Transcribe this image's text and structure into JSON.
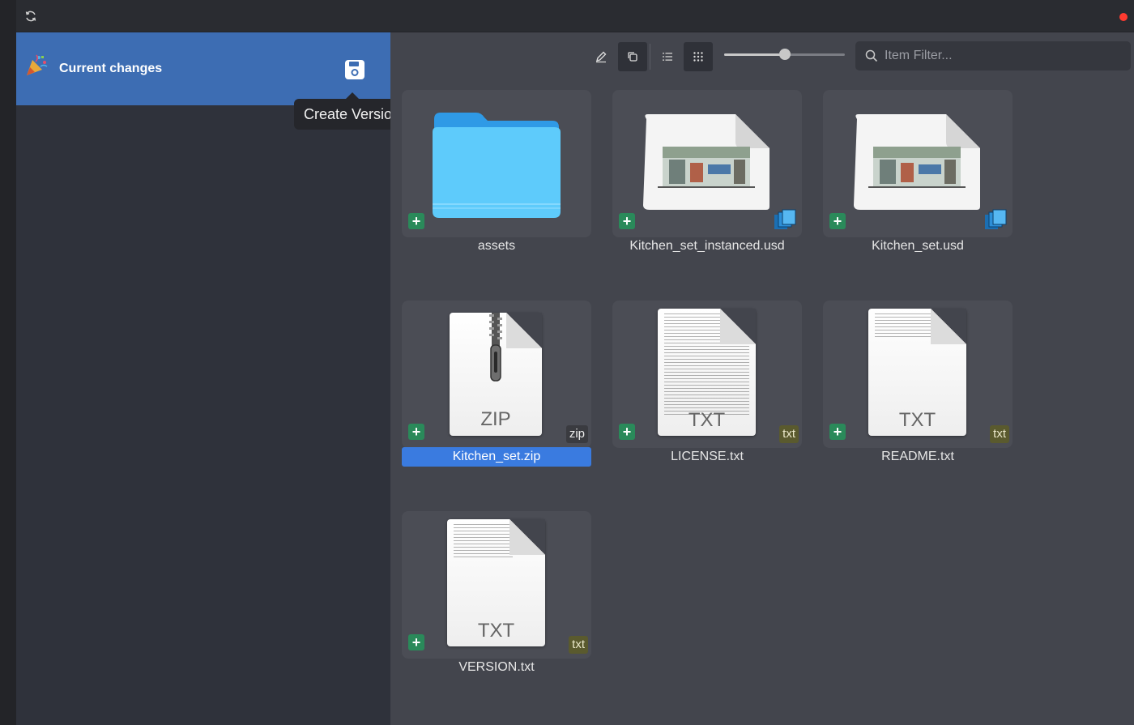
{
  "sidebar": {
    "current_changes_label": "Current changes",
    "tooltip": "Create Version"
  },
  "toolbar": {
    "search_placeholder": "Item Filter...",
    "zoom_level": 0.5
  },
  "items": [
    {
      "name": "assets",
      "kind": "folder",
      "selected": false
    },
    {
      "name": "Kitchen_set_instanced.usd",
      "kind": "usd",
      "selected": false
    },
    {
      "name": "Kitchen_set.usd",
      "kind": "usd",
      "selected": false
    },
    {
      "name": "Kitchen_set.zip",
      "kind": "zip",
      "badge": "zip",
      "doc_type": "ZIP",
      "selected": true
    },
    {
      "name": "LICENSE.txt",
      "kind": "txt",
      "badge": "txt",
      "doc_type": "TXT",
      "selected": false
    },
    {
      "name": "README.txt",
      "kind": "txt",
      "badge": "txt",
      "doc_type": "TXT",
      "selected": false
    },
    {
      "name": "VERSION.txt",
      "kind": "txt",
      "badge": "txt",
      "doc_type": "TXT",
      "selected": false
    }
  ],
  "colors": {
    "accent_selected": "#3a7be0",
    "sidebar_active": "#3d6db3",
    "add_icon": "#2a8a5a",
    "status_dot": "#ff3b30"
  }
}
